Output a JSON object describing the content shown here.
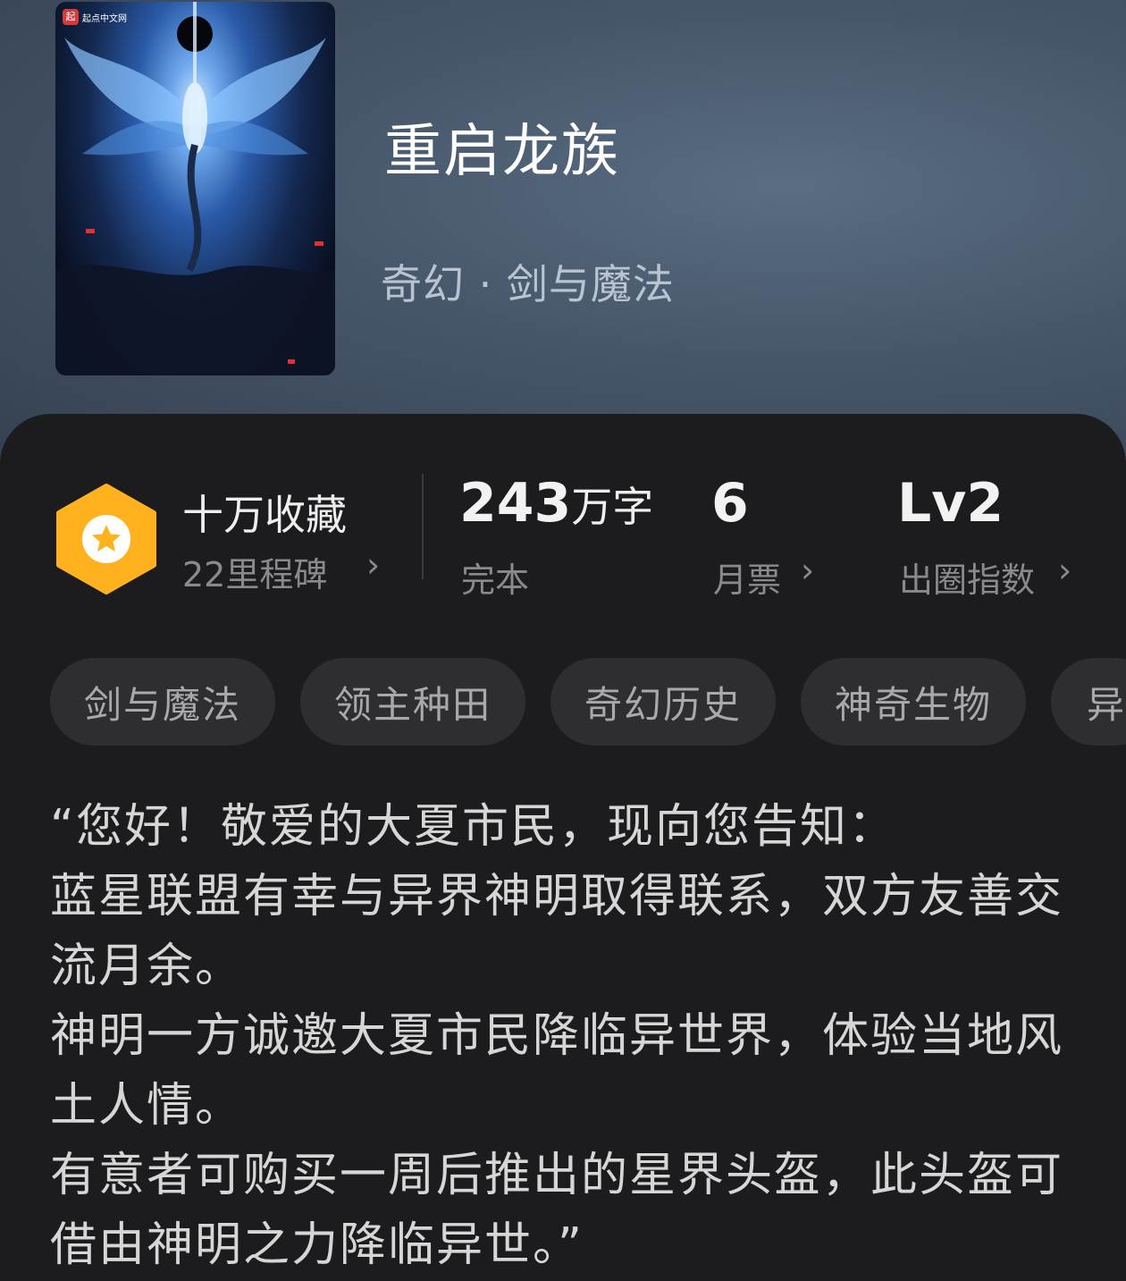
{
  "cover": {
    "badge_logo": "起",
    "badge_text": "起点中文网"
  },
  "book": {
    "title": "重启龙族",
    "genre": "奇幻 · 剑与魔法"
  },
  "stats": {
    "collection_title": "十万收藏",
    "collection_sub": "22里程碑",
    "words_number": "243",
    "words_unit": "万字",
    "status": "完本",
    "monthly_votes_number": "6",
    "monthly_votes_label": "月票",
    "level_value": "Lv2",
    "level_label": "出圈指数",
    "chevron": "›"
  },
  "tags": [
    "剑与魔法",
    "领主种田",
    "奇幻历史",
    "神奇生物",
    "异"
  ],
  "description": [
    "“您好！敬爱的大夏市民，现向您告知：",
    "蓝星联盟有幸与异界神明取得联系，双方友善交流月余。",
    "神明一方诚邀大夏市民降临异世界，体验当地风土人情。",
    "有意者可购买一周后推出的星界头盔，此头盔可借由神明之力降临异世。”"
  ],
  "colors": {
    "accent_orange": "#ffb21e",
    "panel_bg": "#1c1c1e",
    "tag_bg": "#2e2e30"
  }
}
